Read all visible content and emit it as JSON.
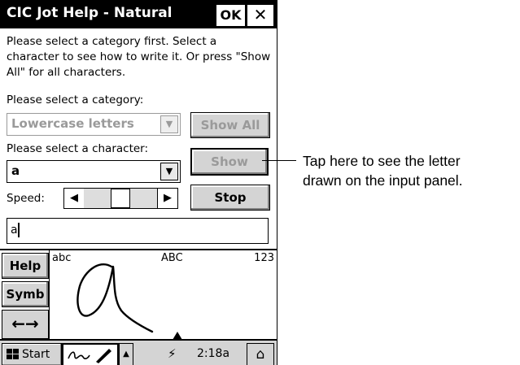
{
  "window": {
    "title": "CIC Jot Help - Natural",
    "ok_label": "OK",
    "close_glyph": "✕"
  },
  "intro_text": "Please select a category first. Select a character to see how to write it. Or press \"Show All\" for all characters.",
  "category": {
    "label": "Please select a category:",
    "value": "Lowercase letters",
    "enabled": false
  },
  "character": {
    "label": "Please select a character:",
    "value": "a"
  },
  "buttons": {
    "show_all": "Show All",
    "show": "Show",
    "stop": "Stop"
  },
  "speed": {
    "label": "Speed:",
    "level": 0.5
  },
  "text_input": {
    "value": "a"
  },
  "input_panel": {
    "help": "Help",
    "symb": "Symb",
    "arrows": "←→",
    "hint_lower": "abc",
    "hint_upper": "ABC",
    "hint_numbers": "123"
  },
  "taskbar": {
    "start": "Start",
    "clock": "2:18a"
  },
  "callout": {
    "line1": "Tap here to see the letter",
    "line2": "drawn on the input panel."
  },
  "icons": [
    "close-icon",
    "dropdown-arrow-icon",
    "scroll-left-icon",
    "scroll-right-icon",
    "windows-flag-icon",
    "pen-input-icon",
    "up-arrow-icon",
    "power-plug-icon",
    "desktop-icon"
  ]
}
